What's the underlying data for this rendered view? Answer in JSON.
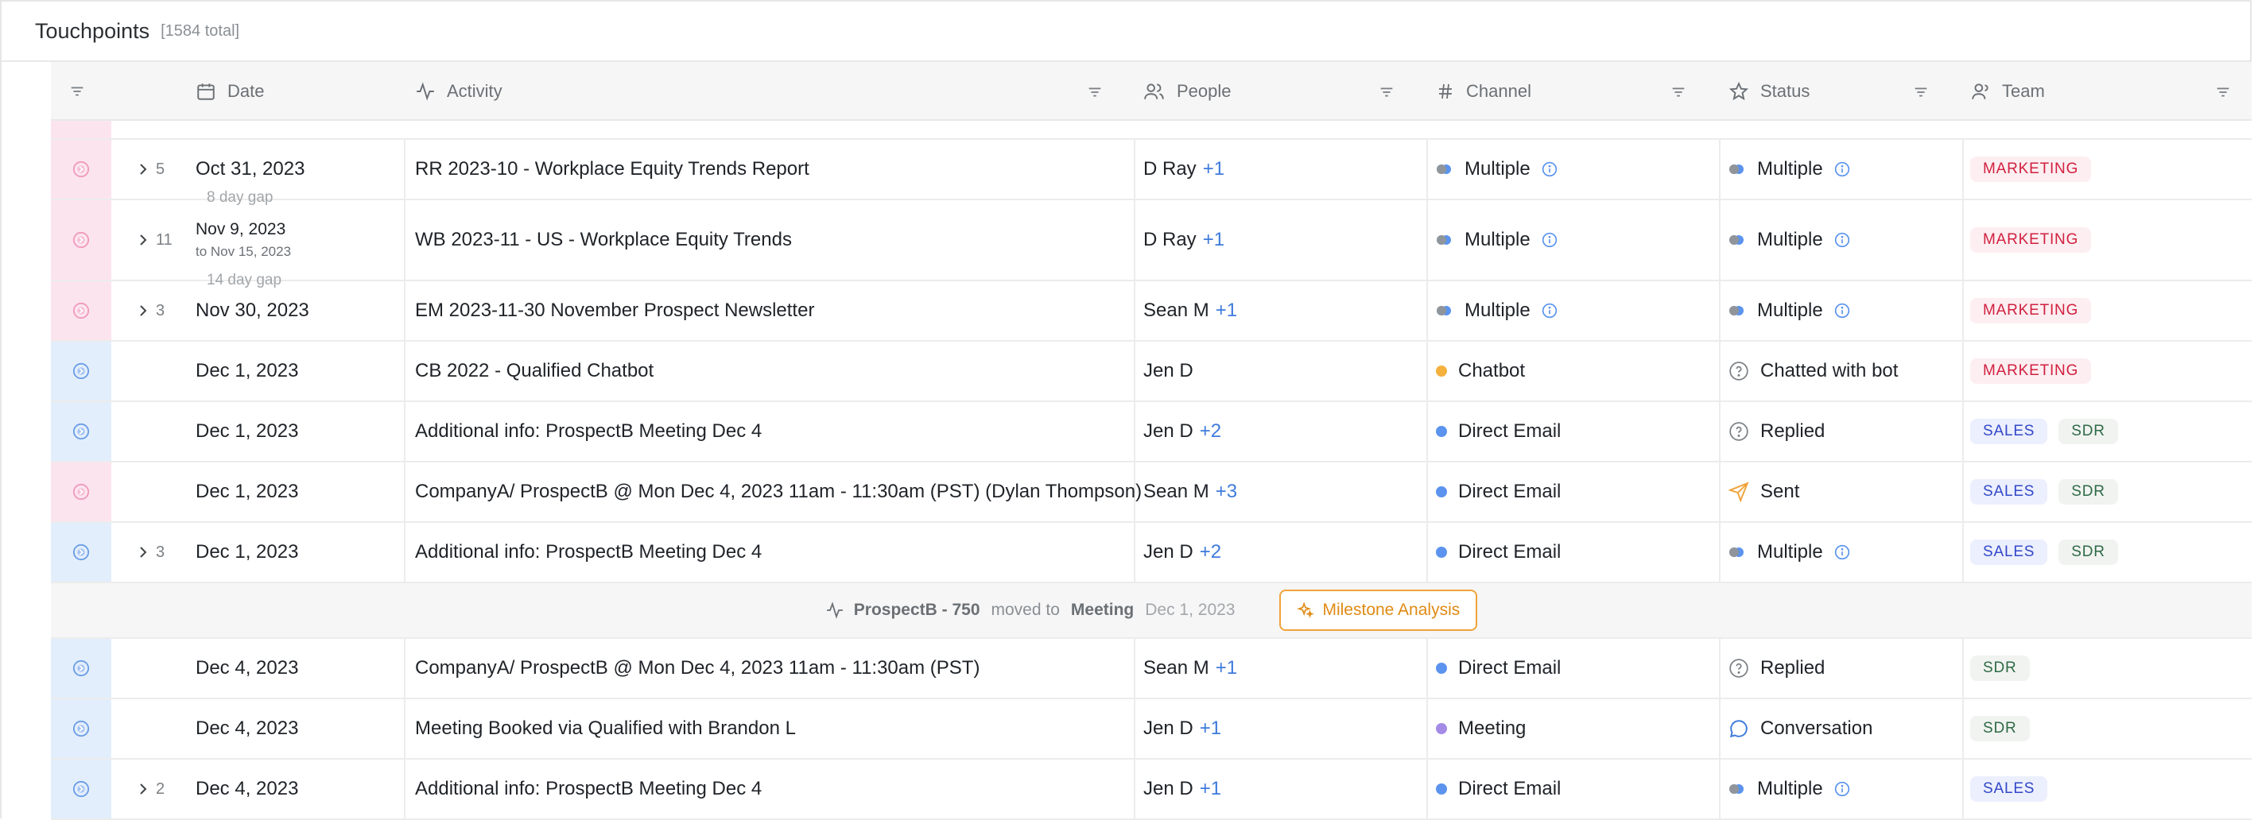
{
  "header": {
    "title": "Touchpoints",
    "count": "[1584 total]"
  },
  "columns": {
    "date": "Date",
    "activity": "Activity",
    "people": "People",
    "channel": "Channel",
    "status": "Status",
    "team": "Team"
  },
  "gaps": [
    "8 day gap",
    "14 day gap"
  ],
  "rows": [
    {
      "marker": "pink",
      "expand": "5",
      "date": "Oct 31, 2023",
      "activity": "RR 2023-10 - Workplace Equity Trends Report",
      "person": "D Ray",
      "plus": "+1",
      "channel": "Multiple",
      "channel_type": "multiple",
      "status": "Multiple",
      "status_type": "multiple",
      "tags": [
        "MARKETING"
      ]
    },
    {
      "marker": "pink",
      "expand": "11",
      "date": "Nov 9, 2023",
      "subdate": "to Nov 15, 2023",
      "activity": "WB 2023-11 - US - Workplace Equity Trends",
      "person": "D Ray",
      "plus": "+1",
      "channel": "Multiple",
      "channel_type": "multiple",
      "status": "Multiple",
      "status_type": "multiple",
      "tags": [
        "MARKETING"
      ]
    },
    {
      "marker": "pink",
      "expand": "3",
      "date": "Nov 30, 2023",
      "activity": "EM 2023-11-30 November Prospect Newsletter",
      "person": "Sean M",
      "plus": "+1",
      "channel": "Multiple",
      "channel_type": "multiple",
      "status": "Multiple",
      "status_type": "multiple",
      "tags": [
        "MARKETING"
      ]
    },
    {
      "marker": "blue",
      "expand": "",
      "date": "Dec 1, 2023",
      "activity": "CB 2022 - Qualified Chatbot",
      "person": "Jen D",
      "plus": "",
      "channel": "Chatbot",
      "channel_type": "chatbot",
      "status": "Chatted with bot",
      "status_type": "question",
      "tags": [
        "MARKETING"
      ]
    },
    {
      "marker": "blue",
      "expand": "",
      "date": "Dec 1, 2023",
      "activity": "Additional info: ProspectB Meeting Dec 4",
      "person": "Jen D",
      "plus": "+2",
      "channel": "Direct Email",
      "channel_type": "email",
      "status": "Replied",
      "status_type": "question",
      "tags": [
        "SALES",
        "SDR"
      ]
    },
    {
      "marker": "pink",
      "expand": "",
      "date": "Dec 1, 2023",
      "activity": "CompanyA/ ProspectB @ Mon Dec 4, 2023 11am - 11:30am (PST) (Dylan Thompson)",
      "person": "Sean M",
      "plus": "+3",
      "channel": "Direct Email",
      "channel_type": "email",
      "status": "Sent",
      "status_type": "sent",
      "tags": [
        "SALES",
        "SDR"
      ]
    },
    {
      "marker": "blue",
      "expand": "3",
      "date": "Dec 1, 2023",
      "activity": "Additional info: ProspectB Meeting Dec 4",
      "person": "Jen D",
      "plus": "+2",
      "channel": "Direct Email",
      "channel_type": "email",
      "status": "Multiple",
      "status_type": "multiple",
      "tags": [
        "SALES",
        "SDR"
      ]
    }
  ],
  "milestone": {
    "title": "ProspectB - 750",
    "moved": "moved to",
    "stage": "Meeting",
    "date": "Dec 1, 2023",
    "button": "Milestone Analysis"
  },
  "rows2": [
    {
      "marker": "blue",
      "expand": "",
      "date": "Dec 4, 2023",
      "activity": "CompanyA/ ProspectB @ Mon Dec 4, 2023 11am - 11:30am (PST)",
      "person": "Sean M",
      "plus": "+1",
      "channel": "Direct Email",
      "channel_type": "email",
      "status": "Replied",
      "status_type": "question",
      "tags": [
        "SDR"
      ]
    },
    {
      "marker": "blue",
      "expand": "",
      "date": "Dec 4, 2023",
      "activity": "Meeting Booked via Qualified with Brandon L",
      "person": "Jen D",
      "plus": "+1",
      "channel": "Meeting",
      "channel_type": "meeting",
      "status": "Conversation",
      "status_type": "conversation",
      "tags": [
        "SDR"
      ]
    },
    {
      "marker": "blue",
      "expand": "2",
      "date": "Dec 4, 2023",
      "activity": "Additional info: ProspectB Meeting Dec 4",
      "person": "Jen D",
      "plus": "+1",
      "channel": "Direct Email",
      "channel_type": "email",
      "status": "Multiple",
      "status_type": "multiple",
      "tags": [
        "SALES"
      ]
    }
  ],
  "colors": {
    "pink_marker": "#fce4ef",
    "blue_marker": "#e3eefc",
    "accent_blue": "#3f7bdc",
    "chatbot": "#f4b13e",
    "email": "#5b93ee",
    "meeting": "#a48be6",
    "milestone": "#f0a33a"
  }
}
